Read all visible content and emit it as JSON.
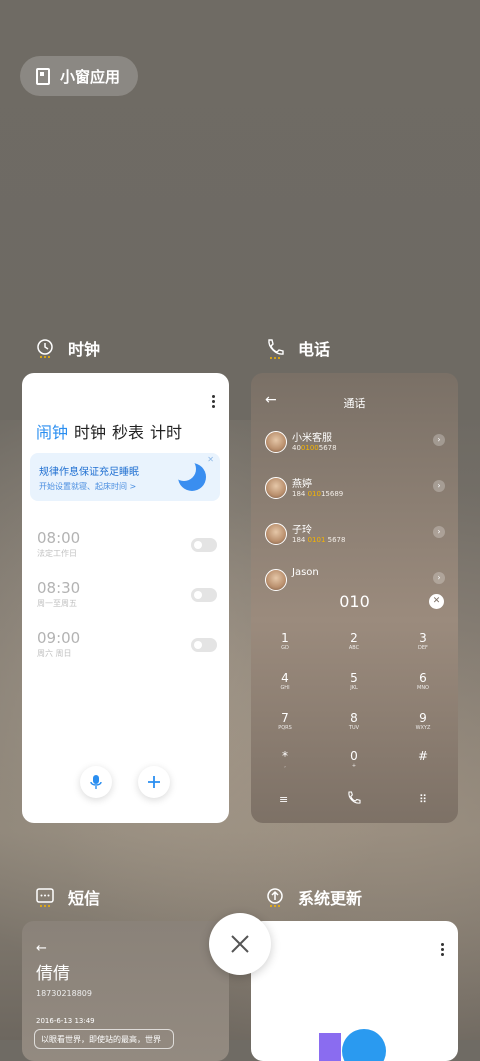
{
  "top_pill": {
    "label": "小窗应用"
  },
  "apps": {
    "clock": {
      "name": "时钟",
      "tabs": [
        "闹钟",
        "时钟",
        "秒表",
        "计时"
      ],
      "banner": {
        "title": "规律作息保证充足睡眠",
        "subtitle": "开始设置就寝、起床时间 >"
      },
      "alarms": [
        {
          "time": "08:00",
          "repeat": "法定工作日"
        },
        {
          "time": "08:30",
          "repeat": "周一至周五"
        },
        {
          "time": "09:00",
          "repeat": "周六 周日"
        }
      ]
    },
    "phone": {
      "name": "电话",
      "title": "通话",
      "contacts": [
        {
          "name": "小米客服",
          "num_a": "40",
          "num_b": "0100",
          "num_c": "5678"
        },
        {
          "name": "燕婷",
          "num_a": "184 ",
          "num_b": "010",
          "num_c": "15689"
        },
        {
          "name": "子玲",
          "num_a": "184 ",
          "num_b": "0101",
          "num_c": " 5678"
        },
        {
          "name": "Jason",
          "num_a": "",
          "num_b": "",
          "num_c": ""
        }
      ],
      "dial_input": "010",
      "keys": [
        {
          "d": "1",
          "l": "GD"
        },
        {
          "d": "2",
          "l": "ABC"
        },
        {
          "d": "3",
          "l": "DEF"
        },
        {
          "d": "4",
          "l": "GHI"
        },
        {
          "d": "5",
          "l": "JKL"
        },
        {
          "d": "6",
          "l": "MNO"
        },
        {
          "d": "7",
          "l": "PQRS"
        },
        {
          "d": "8",
          "l": "TUV"
        },
        {
          "d": "9",
          "l": "WXYZ"
        },
        {
          "d": "*",
          "l": ","
        },
        {
          "d": "0",
          "l": "+"
        },
        {
          "d": "#",
          "l": ""
        }
      ]
    },
    "sms": {
      "name": "短信",
      "contact_name": "倩倩",
      "number": "18730218809",
      "date": "2016-6-13 13:49",
      "preview": "以眼看世界，即使站的最高，世界"
    },
    "update": {
      "name": "系统更新"
    }
  },
  "colors": {
    "accent": "#2a8ef0",
    "highlight": "#f5b400"
  },
  "icons": [
    "clock-icon",
    "phone-icon",
    "sms-icon",
    "update-icon",
    "close-icon",
    "mic-icon",
    "plus-icon"
  ]
}
